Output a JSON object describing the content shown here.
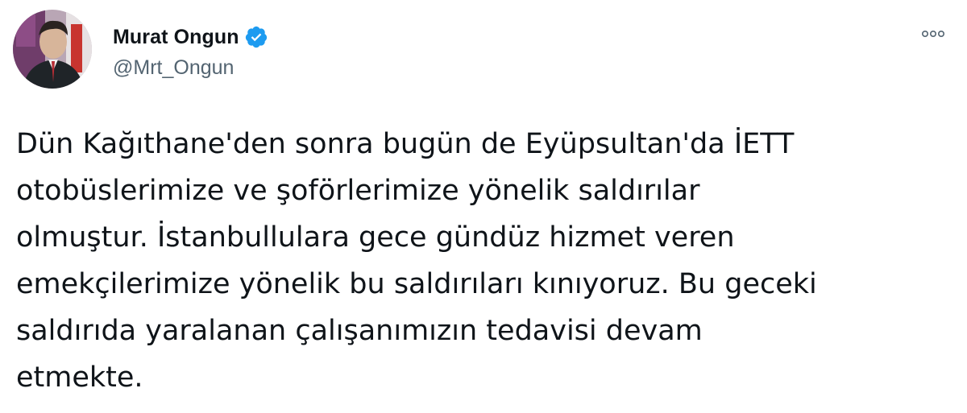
{
  "author": {
    "display_name": "Murat Ongun",
    "handle": "@Mrt_Ongun",
    "verified": true,
    "verified_icon": "verified-badge-icon",
    "avatar_icon": "user-avatar"
  },
  "menu": {
    "more_icon": "more-options-icon"
  },
  "tweet": {
    "lines": [
      "Dün Kağıthane'den sonra bugün de Eyüpsultan'da İETT",
      "otobüslerimize ve şoförlerimize yönelik saldırılar",
      "olmuştur. İstanbullulara gece gündüz hizmet veren",
      "emekçilerimize yönelik bu saldırıları kınıyoruz. Bu geceki",
      "saldırıda yaralanan çalışanımızın tedavisi devam",
      "etmekte."
    ]
  },
  "colors": {
    "text": "#0f1419",
    "secondary": "#536471",
    "verified": "#1d9bf0"
  }
}
